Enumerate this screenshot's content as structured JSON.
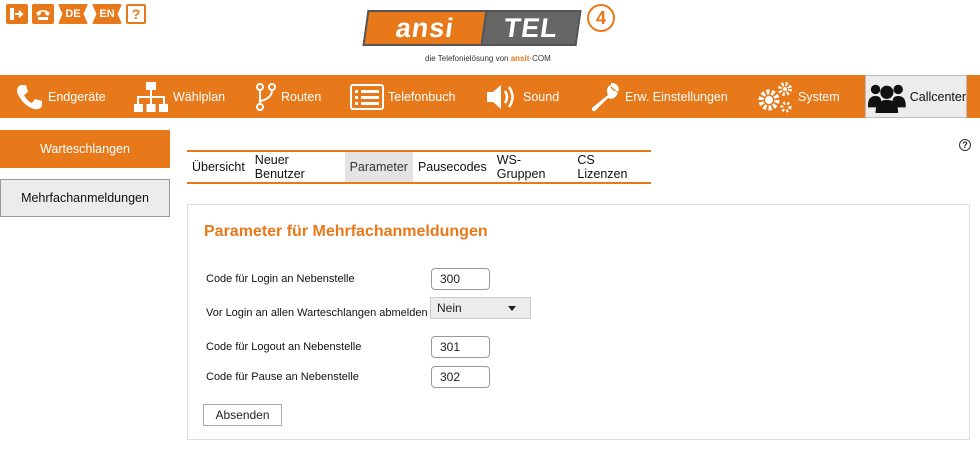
{
  "topbar": {
    "lang_de": "DE",
    "lang_en": "EN",
    "help": "?"
  },
  "logo": {
    "part1": "ansi",
    "part2": "TEL",
    "version": "4",
    "subtitle_prefix": "die Telefonielösung von",
    "subtitle_brand": "ansit",
    "subtitle_suffix": "COM"
  },
  "nav": {
    "items": [
      {
        "label": "Endgeräte",
        "icon": "phone-icon"
      },
      {
        "label": "Wählplan",
        "icon": "hierarchy-icon"
      },
      {
        "label": "Routen",
        "icon": "route-icon"
      },
      {
        "label": "Telefonbuch",
        "icon": "list-icon"
      },
      {
        "label": "Sound",
        "icon": "speaker-icon"
      },
      {
        "label": "Erw. Einstellungen",
        "icon": "wrench-icon"
      },
      {
        "label": "System",
        "icon": "gears-icon"
      },
      {
        "label": "Callcenter",
        "icon": "users-icon"
      }
    ]
  },
  "sidebar": {
    "items": [
      {
        "label": "Warteschlangen"
      },
      {
        "label": "Mehrfachanmeldungen"
      }
    ]
  },
  "tabs": [
    {
      "label": "Übersicht"
    },
    {
      "label": "Neuer Benutzer"
    },
    {
      "label": "Parameter"
    },
    {
      "label": "Pausecodes"
    },
    {
      "label": "WS-Gruppen"
    },
    {
      "label": "CS Lizenzen"
    }
  ],
  "panel": {
    "title": "Parameter für Mehrfachanmeldungen",
    "login_label": "Code für Login an Nebenstelle",
    "login_value": "300",
    "logout_all_label": "Vor Login an allen Warteschlangen abmelden",
    "logout_all_value": "Nein",
    "logout_label": "Code für Logout an Nebenstelle",
    "logout_value": "301",
    "pause_label": "Code für Pause an Nebenstelle",
    "pause_value": "302",
    "submit_label": "Absenden"
  },
  "colors": {
    "accent": "#e8791a",
    "logo_gray": "#666666"
  }
}
